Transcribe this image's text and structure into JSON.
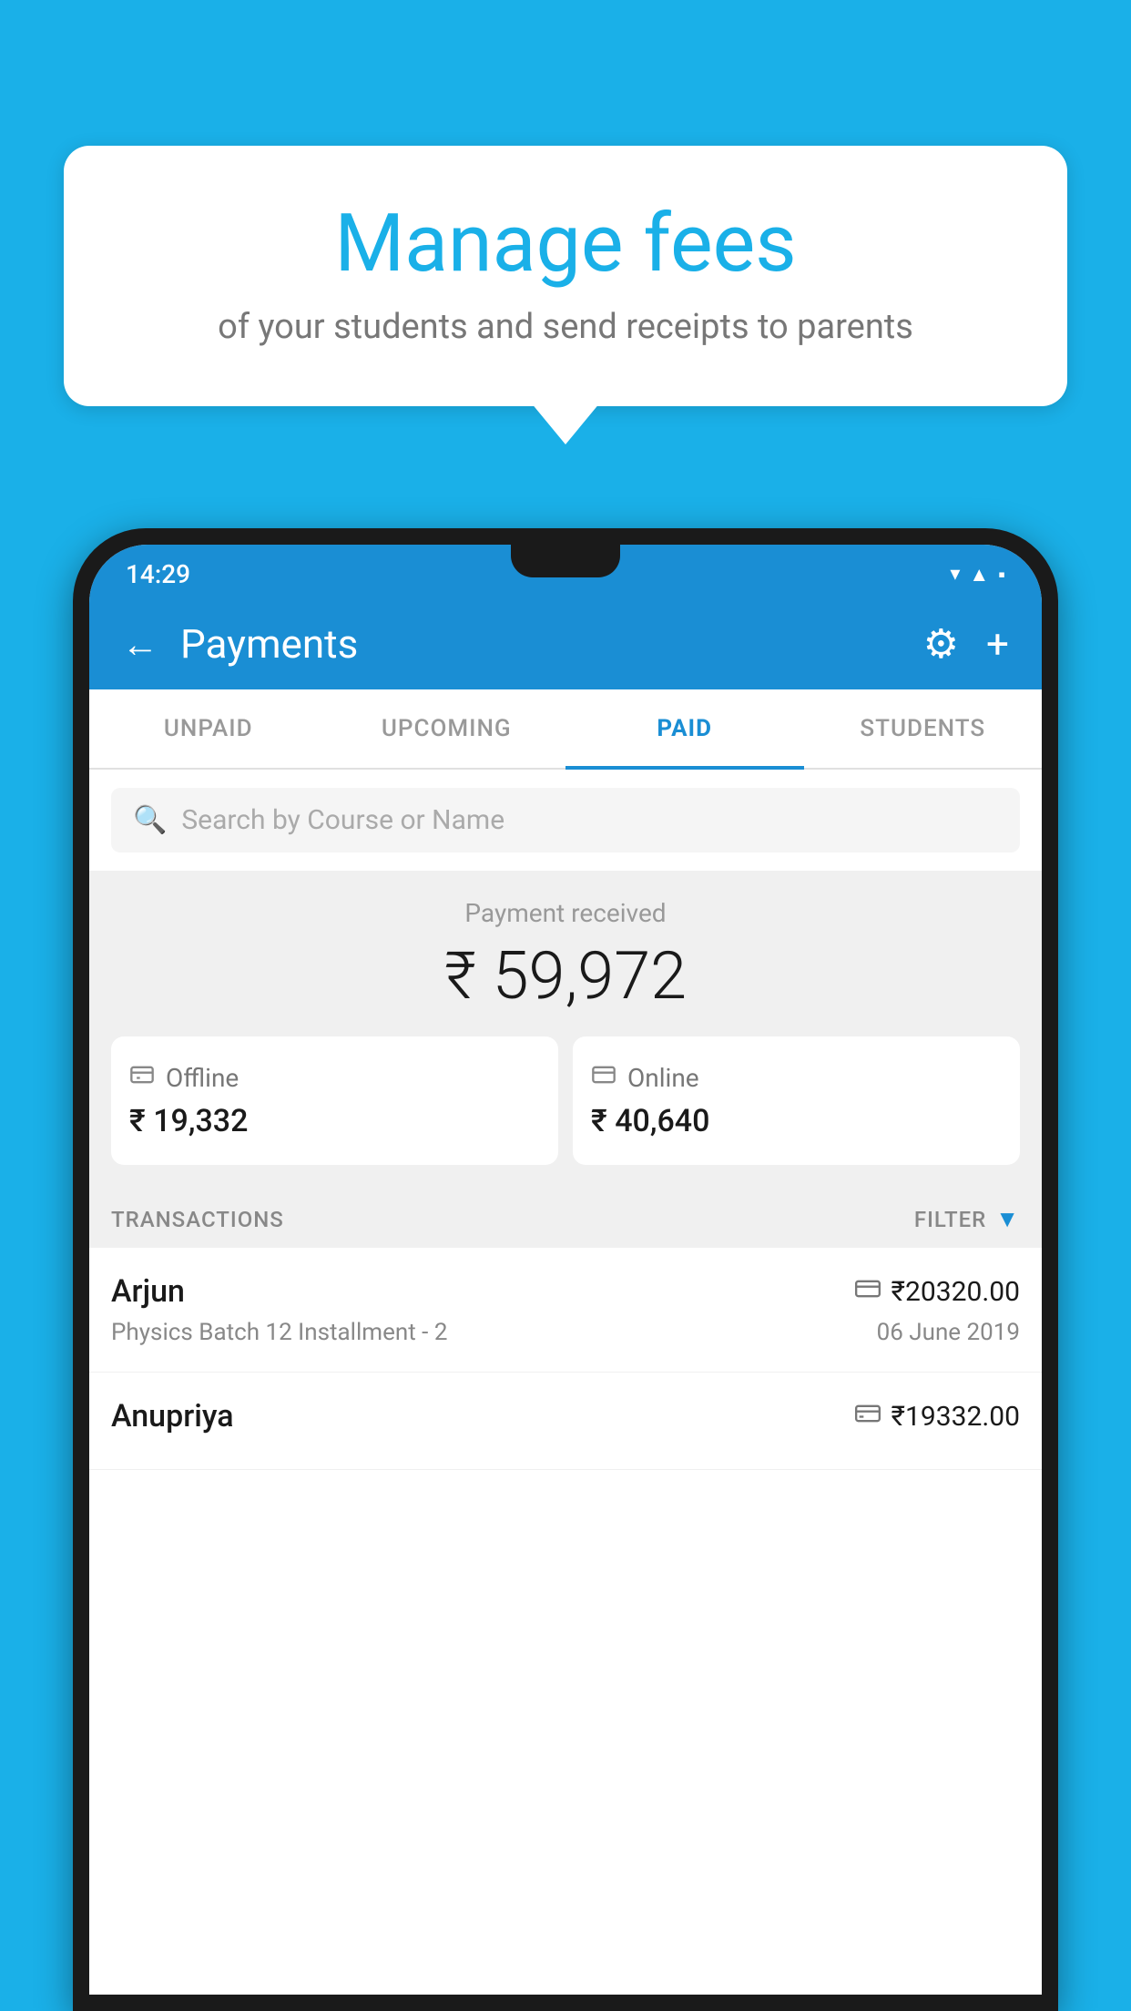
{
  "background_color": "#1ab0e8",
  "bubble": {
    "title": "Manage fees",
    "subtitle": "of your students and send receipts to parents"
  },
  "phone": {
    "status_bar": {
      "time": "14:29",
      "wifi_icon": "▼",
      "signal_icon": "▲",
      "battery_icon": "▪"
    },
    "header": {
      "title": "Payments",
      "back_label": "←",
      "gear_label": "⚙",
      "plus_label": "+"
    },
    "tabs": [
      {
        "label": "UNPAID",
        "active": false
      },
      {
        "label": "UPCOMING",
        "active": false
      },
      {
        "label": "PAID",
        "active": true
      },
      {
        "label": "STUDENTS",
        "active": false
      }
    ],
    "search": {
      "placeholder": "Search by Course or Name"
    },
    "payment_summary": {
      "label": "Payment received",
      "amount": "₹ 59,972",
      "offline": {
        "icon": "💳",
        "label": "Offline",
        "amount": "₹ 19,332"
      },
      "online": {
        "icon": "💳",
        "label": "Online",
        "amount": "₹ 40,640"
      }
    },
    "transactions": {
      "label": "TRANSACTIONS",
      "filter_label": "FILTER",
      "items": [
        {
          "name": "Arjun",
          "payment_type": "online",
          "amount": "₹20320.00",
          "course": "Physics Batch 12 Installment - 2",
          "date": "06 June 2019"
        },
        {
          "name": "Anupriya",
          "payment_type": "offline",
          "amount": "₹19332.00",
          "course": "",
          "date": ""
        }
      ]
    }
  }
}
